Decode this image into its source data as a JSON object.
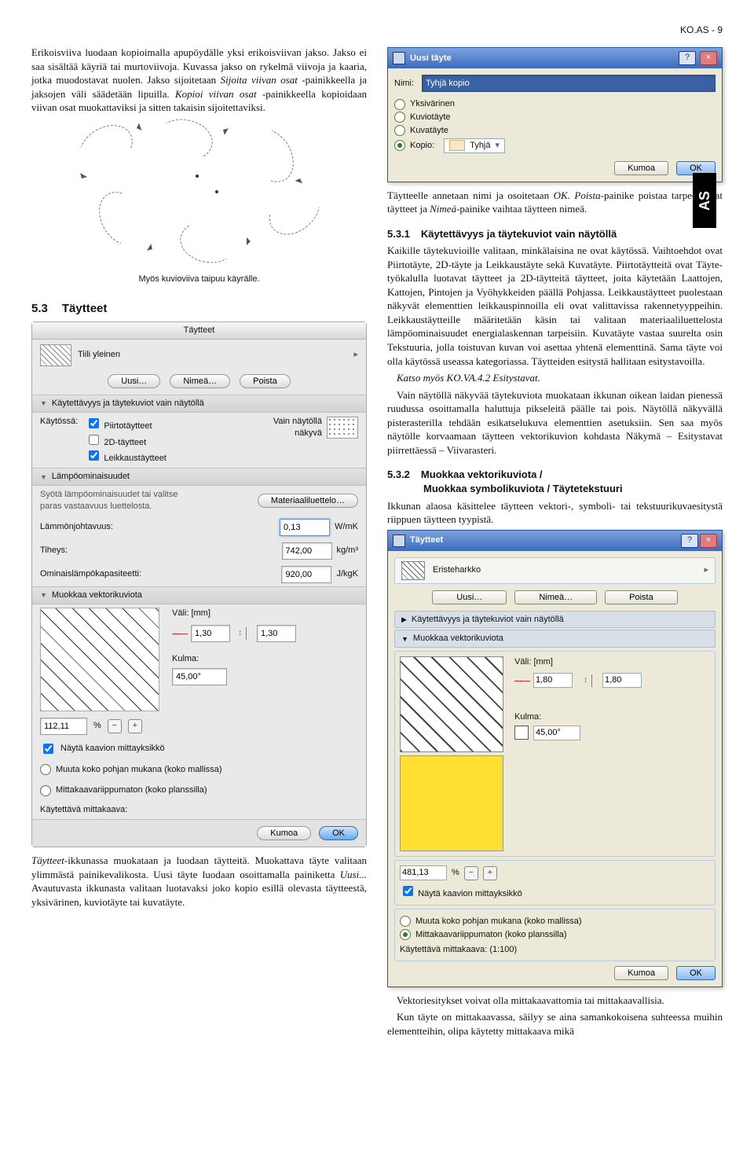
{
  "header": {
    "page_code": "KO.AS - 9"
  },
  "sidebar_badge": "AS",
  "col_left": {
    "para1": "Erikoisviiva luodaan kopioimalla apupöydälle yksi erikoisviivan jakso. Jakso ei saa sisältää käyriä tai murtoviivoja. Kuvassa jakso on rykelmä viivoja ja kaaria, jotka muodostavat nuolen. Jakso sijoitetaan ",
    "para1b": "Sijoita viivan osat",
    "para1c": " -painikkeella ja jaksojen väli säädetään lipuilla. ",
    "para1d": "Kopioi viivan osat",
    "para1e": " -painikkeella kopioidaan viivan osat muokattaviksi ja sitten takaisin sijoitettaviksi.",
    "fig_caption": "Myös kuvioviiva taipuu käyrälle.",
    "section_53_num": "5.3",
    "section_53_title": "Täytteet"
  },
  "taytteet_panel": {
    "title": "Täytteet",
    "fill_name": "Tiili yleinen",
    "btn_new": "Uusi…",
    "btn_rename": "Nimeä…",
    "btn_delete": "Poista",
    "sec1": "Käytettävyys ja täytekuviot vain näytöllä",
    "used_in": "Käytössä:",
    "chk_draw": "Piirtotäytteet",
    "chk_2d": "2D-täytteet",
    "chk_cut": "Leikkaustäytteet",
    "screenonly_lbl1": "Vain näytöllä",
    "screenonly_lbl2": "näkyvä",
    "sec2": "Lämpöominaisuudet",
    "thermal_hint": "Syötä lämpöominaisuudet tai valitse paras vastaavuus luettelosta.",
    "btn_material": "Materiaaliluettelo…",
    "conductivity_lbl": "Lämmönjohtavuus:",
    "conductivity_val": "0,13",
    "conductivity_unit": "W/mK",
    "density_lbl": "Tiheys:",
    "density_val": "742,00",
    "density_unit": "kg/m³",
    "heatcap_lbl": "Ominaislämpökapasiteetti:",
    "heatcap_val": "920,00",
    "heatcap_unit": "J/kgK",
    "sec3": "Muokkaa vektorikuviota",
    "spacing_label": "Väli: [mm]",
    "spacing_h": "1,30",
    "spacing_v": "1,30",
    "angle_label": "Kulma:",
    "angle_val": "45,00°",
    "scale_val": "112,11",
    "scale_unit": "%",
    "show_scale_chk": "Näytä kaavion mittayksikkö",
    "opt_scale_model": "Muuta koko pohjan mukana (koko mallissa)",
    "opt_scale_plan": "Mittakaavariippumaton (koko planssilla)",
    "used_scale": "Käytettävä mittakaava:",
    "btn_cancel": "Kumoa",
    "btn_ok": "OK"
  },
  "col_left_footer": "Täytteet-ikkunassa muokataan ja luodaan täytteitä. Muokattava täyte valitaan ylimmästä painikevalikosta. Uusi täyte luodaan osoittamalla painiketta Uusi... Avautuvasta ikkunasta valitaan luotavaksi joko kopio esillä olevasta täytteestä, yksivärinen, kuviotäyte tai kuvatäyte.",
  "uusi_tayte": {
    "title": "Uusi täyte",
    "name_label": "Nimi:",
    "name_val": "Tyhjä kopio",
    "opt_solid": "Yksivärinen",
    "opt_pattern": "Kuviotäyte",
    "opt_image": "Kuvatäyte",
    "opt_copy": "Kopio:",
    "copy_of": "Tyhjä",
    "btn_cancel": "Kumoa",
    "btn_ok": "OK"
  },
  "right_text": {
    "p1a": "Täytteelle annetaan nimi ja osoitetaan ",
    "p1b": "OK",
    "p1c": ". ",
    "p1d": "Poista",
    "p1e": "-painike poistaa tarpeettomat täytteet ja ",
    "p1f": "Nimeä",
    "p1g": "-painike vaihtaa täytteen nimeä.",
    "h531_num": "5.3.1",
    "h531_title": "Käytettävyys ja täytekuviot vain näytöllä",
    "p2": "Kaikille täytekuvioille valitaan, minkälaisina ne ovat käytössä. Vaihtoehdot ovat Piirtotäyte, 2D-täyte ja Leikkaustäyte sekä Kuvatäyte. Piirtotäytteitä ovat Täyte-työkalulla luotavat täytteet ja 2D-täytteitä täytteet, joita käytetään Laattojen, Kattojen, Pintojen ja Vyöhykkeiden päällä Pohjassa. Leikkaustäytteet puolestaan näkyvät elementtien leikkauspinnoilla eli ovat valittavissa rakennetyyppeihin. Leikkaustäytteille määritetään käsin tai valitaan materiaaliluettelosta lämpöominaisuudet energialaskennan tarpeisiin. Kuvatäyte vastaa suurelta osin Tekstuuria, jolla toistuvan kuvan voi asettaa yhtenä elementtinä. Sama täyte voi olla käytössä useassa kategoriassa. Täytteiden esitystä hallitaan esitystavoilla.",
    "p2_ref": "Katso myös KO.VA.4.2 Esitystavat.",
    "p3": "Vain näytöllä näkyvää täytekuviota muokataan ikkunan oikean laidan pienessä ruudussa osoittamalla haluttuja pikseleitä päälle tai pois. Näytöllä näkyvällä pisterasterilla tehdään esikatselukuva elementtien asetuksiin. Sen saa myös näytölle korvaamaan täytteen vektorikuvion kohdasta Näkymä – Esitystavat piirrettäessä – Viivarasteri.",
    "h532_num": "5.3.2",
    "h532_title_l1": "Muokkaa vektorikuviota /",
    "h532_title_l2": "Muokkaa symbolikuviota / Täytetekstuuri",
    "p4": "Ikkunan alaosa käsittelee täytteen vektori-, symboli- tai tekstuurikuvaesitystä riippuen täytteen tyypistä."
  },
  "win_taytteet": {
    "title": "Täytteet",
    "fill_name": "Eristeharkko",
    "btn_new": "Uusi…",
    "btn_rename": "Nimeä…",
    "btn_delete": "Poista",
    "sec1": "Käytettävyys ja täytekuviot vain näytöllä",
    "sec2": "Muokkaa vektorikuviota",
    "spacing_label": "Väli: [mm]",
    "spacing_h": "1,80",
    "spacing_v": "1,80",
    "angle_label": "Kulma:",
    "angle_val": "45,00°",
    "scale_val": "481,13",
    "scale_unit": "%",
    "show_scale_chk": "Näytä kaavion mittayksikkö",
    "opt_scale_model": "Muuta koko pohjan mukana (koko mallissa)",
    "opt_scale_plan": "Mittakaavariippumaton (koko planssilla)",
    "used_scale": "Käytettävä mittakaava: (1:100)",
    "btn_cancel": "Kumoa",
    "btn_ok": "OK"
  },
  "footer_right": {
    "p1": "Vektoriesitykset voivat olla mittakaavattomia tai mittakaavallisia.",
    "p2": "Kun täyte on mittakaavassa, säilyy se aina samankokoisena suhteessa muihin elementteihin, olipa käytetty mittakaava mikä"
  }
}
